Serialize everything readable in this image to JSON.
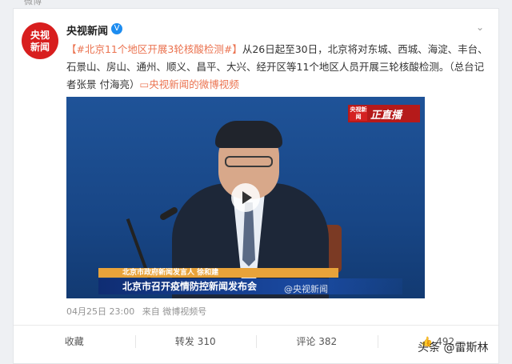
{
  "top_strip": {
    "text": "微博"
  },
  "account": {
    "avatar_line1": "央视",
    "avatar_line2": "新闻",
    "name": "央视新闻",
    "verified_mark": "V"
  },
  "post": {
    "hashtag": "【#北京11个地区开展3轮核酸检测#】",
    "body": "从26日起至30日，北京将对东城、西城、海淀、丰台、石景山、房山、通州、顺义、昌平、大兴、经开区等11个地区人员开展三轮核酸检测。（总台记者张景 付海亮）",
    "video_link": "央视新闻的微博视频"
  },
  "video": {
    "live_logo_text": "央视新闻",
    "live_label": "正直播",
    "speaker_caption": "北京市政府新闻发言人 徐和建",
    "headline": "北京市召开疫情防控新闻发布会",
    "watermark": "@央视新闻"
  },
  "meta": {
    "timestamp": "04月25日 23:00",
    "source": "来自 微博视频号"
  },
  "actions": {
    "favorite": "收藏",
    "repost": "转发 310",
    "comment": "评论 382",
    "like": "492"
  },
  "source_badge": "头条 @雷斯林",
  "colors": {
    "accent_link": "#eb7350",
    "brand_red": "#d81e1e",
    "verified_blue": "#1d8cf0"
  }
}
